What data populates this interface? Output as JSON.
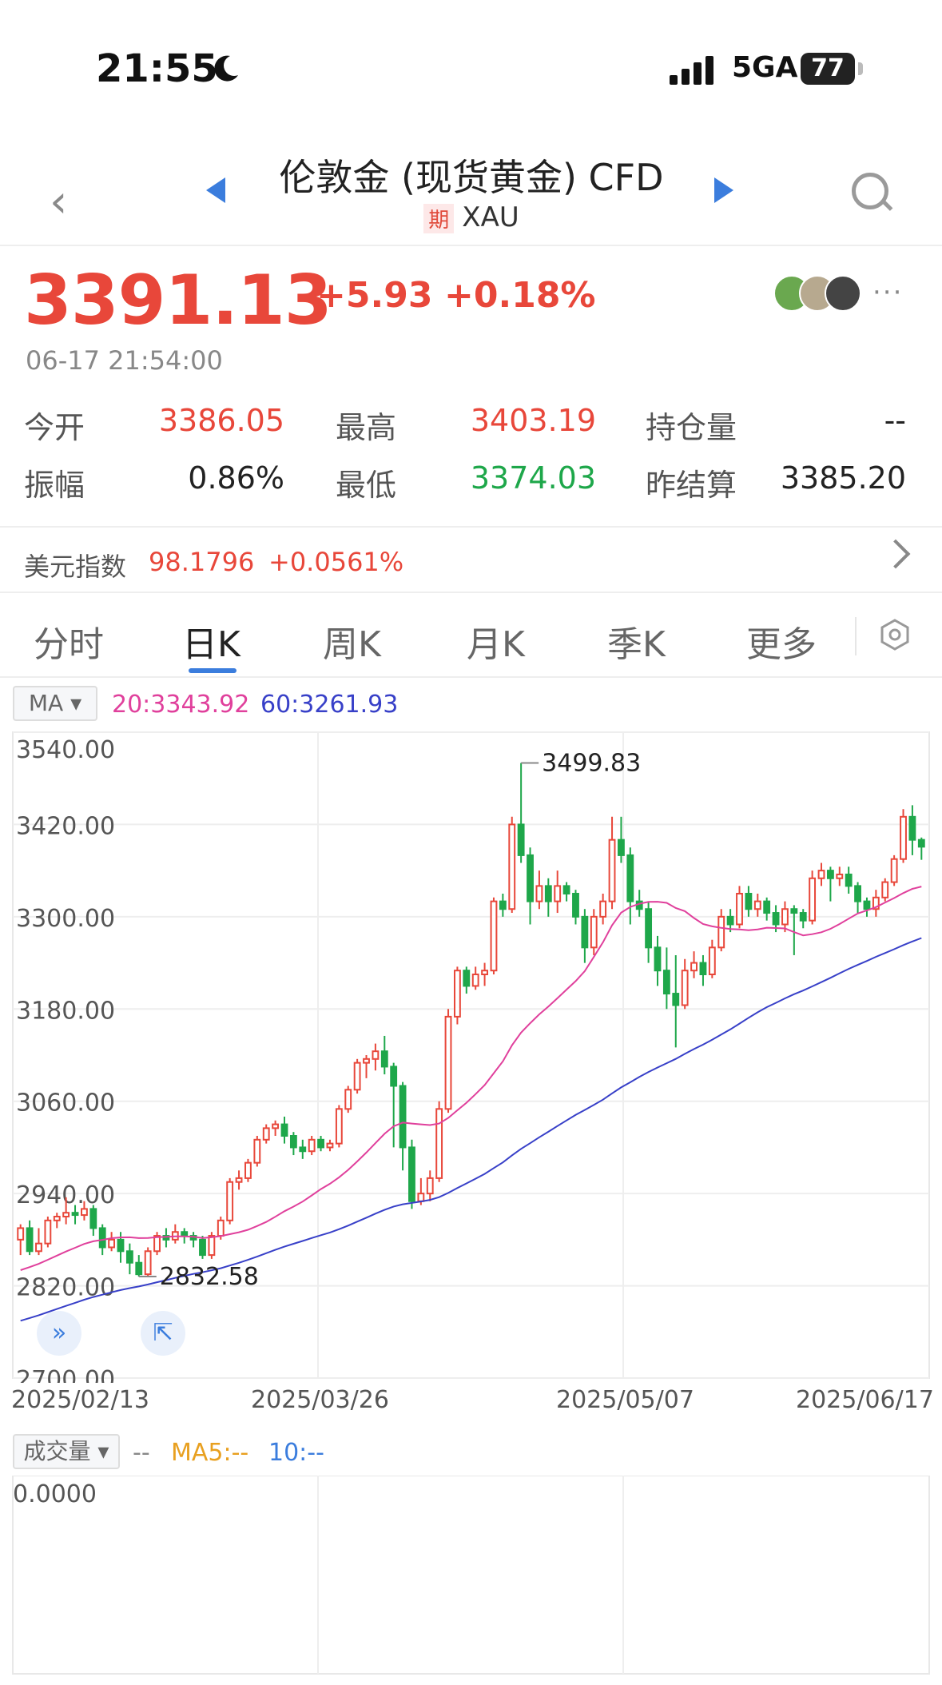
{
  "status_bar": {
    "time": "21:55",
    "network": "5GA",
    "battery": "77"
  },
  "header": {
    "title": "伦敦金 (现货黄金) CFD",
    "badge": "期",
    "symbol": "XAU"
  },
  "quote": {
    "price": "3391.13",
    "change": "+5.93",
    "change_pct": "+0.18%",
    "timestamp": "06-17 21:54:00",
    "open_label": "今开",
    "open": "3386.05",
    "high_label": "最高",
    "high": "3403.19",
    "oi_label": "持仓量",
    "oi": "--",
    "amp_label": "振幅",
    "amp": "0.86%",
    "low_label": "最低",
    "low": "3374.03",
    "settle_label": "昨结算",
    "settle": "3385.20"
  },
  "usd_index": {
    "label": "美元指数",
    "value": "98.1796",
    "change": "+0.0561%"
  },
  "tabs": [
    {
      "label": "分时"
    },
    {
      "label": "日K"
    },
    {
      "label": "周K"
    },
    {
      "label": "月K"
    },
    {
      "label": "季K"
    },
    {
      "label": "更多"
    }
  ],
  "active_tab": "日K",
  "indicator": {
    "selector": "MA",
    "ma20": "20:3343.92",
    "ma60": "60:3261.93"
  },
  "colors": {
    "up": "#e8473a",
    "down": "#1ea74a",
    "ma20": "#e0409c",
    "ma60": "#3840c8",
    "accent": "#3b7ddd"
  },
  "chart_data": {
    "type": "candlestick",
    "title": "",
    "y_ticks": [
      "3540.00",
      "3420.00",
      "3300.00",
      "3180.00",
      "3060.00",
      "2940.00",
      "2820.00",
      "2700.00"
    ],
    "ylim": [
      2700,
      3540
    ],
    "x_ticks": [
      "2025/02/13",
      "2025/03/26",
      "2025/05/07",
      "2025/06/17"
    ],
    "max_label": "3499.83",
    "min_label": "2832.58",
    "candles": [
      [
        2880,
        2895,
        2860,
        2900
      ],
      [
        2895,
        2865,
        2860,
        2905
      ],
      [
        2865,
        2875,
        2860,
        2895
      ],
      [
        2875,
        2905,
        2870,
        2910
      ],
      [
        2905,
        2910,
        2895,
        2915
      ],
      [
        2910,
        2915,
        2900,
        2935
      ],
      [
        2915,
        2912,
        2900,
        2925
      ],
      [
        2912,
        2920,
        2905,
        2930
      ],
      [
        2920,
        2895,
        2885,
        2925
      ],
      [
        2895,
        2870,
        2860,
        2900
      ],
      [
        2870,
        2880,
        2865,
        2890
      ],
      [
        2880,
        2865,
        2850,
        2890
      ],
      [
        2865,
        2850,
        2835,
        2875
      ],
      [
        2850,
        2835,
        2832,
        2860
      ],
      [
        2835,
        2865,
        2833,
        2870
      ],
      [
        2865,
        2885,
        2860,
        2890
      ],
      [
        2885,
        2880,
        2870,
        2895
      ],
      [
        2880,
        2890,
        2875,
        2900
      ],
      [
        2890,
        2885,
        2875,
        2895
      ],
      [
        2885,
        2880,
        2870,
        2890
      ],
      [
        2880,
        2860,
        2855,
        2885
      ],
      [
        2860,
        2885,
        2855,
        2890
      ],
      [
        2885,
        2905,
        2880,
        2910
      ],
      [
        2905,
        2955,
        2900,
        2960
      ],
      [
        2955,
        2960,
        2945,
        2970
      ],
      [
        2960,
        2980,
        2955,
        2985
      ],
      [
        2980,
        3010,
        2975,
        3015
      ],
      [
        3010,
        3025,
        3005,
        3030
      ],
      [
        3025,
        3030,
        3015,
        3035
      ],
      [
        3030,
        3015,
        3005,
        3040
      ],
      [
        3015,
        3000,
        2990,
        3020
      ],
      [
        3000,
        2995,
        2985,
        3010
      ],
      [
        2995,
        3010,
        2990,
        3015
      ],
      [
        3010,
        3000,
        2995,
        3015
      ],
      [
        3000,
        3005,
        2995,
        3010
      ],
      [
        3005,
        3050,
        3000,
        3055
      ],
      [
        3050,
        3075,
        3045,
        3080
      ],
      [
        3075,
        3110,
        3070,
        3115
      ],
      [
        3110,
        3115,
        3090,
        3120
      ],
      [
        3115,
        3125,
        3100,
        3135
      ],
      [
        3125,
        3105,
        3095,
        3145
      ],
      [
        3105,
        3080,
        3000,
        3110
      ],
      [
        3080,
        3000,
        2970,
        3085
      ],
      [
        3000,
        2930,
        2920,
        3010
      ],
      [
        2930,
        2940,
        2925,
        2960
      ],
      [
        2940,
        2960,
        2930,
        2970
      ],
      [
        2960,
        3050,
        2955,
        3060
      ],
      [
        3050,
        3170,
        3045,
        3180
      ],
      [
        3170,
        3230,
        3160,
        3235
      ],
      [
        3230,
        3210,
        3200,
        3235
      ],
      [
        3210,
        3225,
        3205,
        3235
      ],
      [
        3225,
        3230,
        3210,
        3240
      ],
      [
        3230,
        3320,
        3225,
        3325
      ],
      [
        3320,
        3310,
        3300,
        3330
      ],
      [
        3310,
        3420,
        3305,
        3430
      ],
      [
        3420,
        3380,
        3370,
        3500
      ],
      [
        3380,
        3320,
        3290,
        3390
      ],
      [
        3320,
        3340,
        3310,
        3360
      ],
      [
        3340,
        3320,
        3300,
        3350
      ],
      [
        3320,
        3340,
        3305,
        3360
      ],
      [
        3340,
        3330,
        3320,
        3345
      ],
      [
        3330,
        3300,
        3290,
        3335
      ],
      [
        3300,
        3260,
        3240,
        3310
      ],
      [
        3260,
        3300,
        3250,
        3310
      ],
      [
        3300,
        3320,
        3290,
        3330
      ],
      [
        3320,
        3400,
        3310,
        3430
      ],
      [
        3400,
        3380,
        3370,
        3430
      ],
      [
        3380,
        3320,
        3290,
        3390
      ],
      [
        3320,
        3310,
        3300,
        3335
      ],
      [
        3310,
        3260,
        3240,
        3320
      ],
      [
        3260,
        3230,
        3210,
        3275
      ],
      [
        3230,
        3200,
        3180,
        3260
      ],
      [
        3200,
        3185,
        3130,
        3250
      ],
      [
        3185,
        3230,
        3180,
        3245
      ],
      [
        3230,
        3240,
        3220,
        3255
      ],
      [
        3240,
        3225,
        3210,
        3250
      ],
      [
        3225,
        3260,
        3220,
        3270
      ],
      [
        3260,
        3300,
        3255,
        3310
      ],
      [
        3300,
        3290,
        3280,
        3310
      ],
      [
        3290,
        3330,
        3285,
        3340
      ],
      [
        3330,
        3310,
        3300,
        3340
      ],
      [
        3310,
        3320,
        3300,
        3330
      ],
      [
        3320,
        3305,
        3295,
        3325
      ],
      [
        3305,
        3290,
        3280,
        3315
      ],
      [
        3290,
        3310,
        3280,
        3320
      ],
      [
        3310,
        3305,
        3250,
        3315
      ],
      [
        3305,
        3295,
        3285,
        3310
      ],
      [
        3295,
        3350,
        3290,
        3360
      ],
      [
        3350,
        3360,
        3340,
        3370
      ],
      [
        3360,
        3350,
        3320,
        3365
      ],
      [
        3350,
        3355,
        3340,
        3365
      ],
      [
        3355,
        3340,
        3330,
        3365
      ],
      [
        3340,
        3320,
        3305,
        3345
      ],
      [
        3320,
        3310,
        3300,
        3325
      ],
      [
        3310,
        3325,
        3300,
        3335
      ],
      [
        3325,
        3345,
        3320,
        3350
      ],
      [
        3345,
        3375,
        3340,
        3380
      ],
      [
        3375,
        3430,
        3370,
        3440
      ],
      [
        3430,
        3400,
        3380,
        3445
      ],
      [
        3400,
        3391,
        3374,
        3403
      ]
    ],
    "series": [
      {
        "name": "MA20"
      },
      {
        "name": "MA60"
      }
    ]
  },
  "volume": {
    "selector": "成交量",
    "dash": "--",
    "ma5": "MA5:--",
    "ma10": "10:--",
    "zero": "0.0000"
  }
}
